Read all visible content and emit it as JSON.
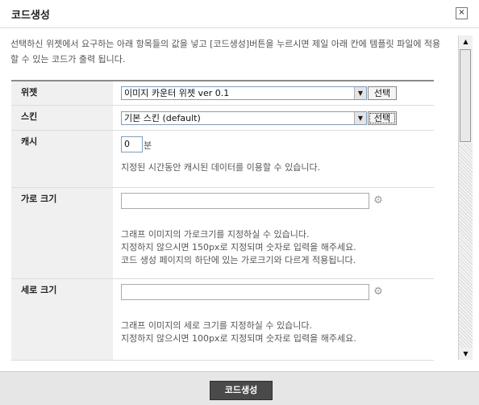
{
  "dialog": {
    "title": "코드생성",
    "close_icon": "×"
  },
  "intro": {
    "text": "선택하신 위젯에서 요구하는 아래 항목들의 값을 넣고 [코드생성]버튼을 누르시면 제일 아래 칸에 템플릿 파일에 적용할 수 있는 코드가 출력 됩니다."
  },
  "form": {
    "widget": {
      "label": "위젯",
      "value": "이미지 카운터 위젯 ver 0.1",
      "button": "선택"
    },
    "skin": {
      "label": "스킨",
      "value": "기본 스킨 (default)",
      "button": "선택"
    },
    "cache": {
      "label": "캐시",
      "value": "0",
      "unit": "분",
      "help": "지정된 시간동안 캐시된 데이터를 이용할 수 있습니다."
    },
    "width": {
      "label": "가로 크기",
      "value": "",
      "help_1": "그래프 이미지의 가로크기를 지정하실 수 있습니다.",
      "help_2": "지정하지 않으시면 150px로 지정되며 숫자로 입력을 해주세요.",
      "help_3": "코드 생성 페이지의 하단에 있는 가로크기와 다르게 적용됩니다."
    },
    "height": {
      "label": "세로 크기",
      "value": "",
      "help_1": "그래프 이미지의 세로 크기를 지정하실 수 있습니다.",
      "help_2": "지정하지 않으시면 100px로 지정되며 숫자로 입력을 해주세요."
    }
  },
  "icons": {
    "dropdown": "▼",
    "gear": "⚙",
    "scroll_up": "▲",
    "scroll_down": "▼"
  },
  "footer": {
    "generate_button": "코드생성"
  }
}
